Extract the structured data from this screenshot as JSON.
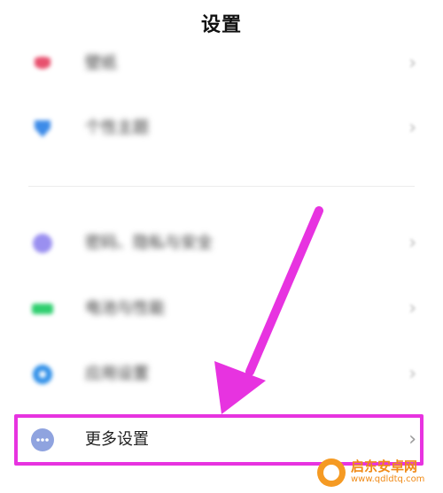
{
  "header": {
    "title": "设置"
  },
  "section1": {
    "items": [
      {
        "label": "壁纸",
        "icon": "wallpaper-icon",
        "color": "#e8506e"
      },
      {
        "label": "个性主题",
        "icon": "theme-icon",
        "color": "#3d8be8"
      }
    ]
  },
  "section2": {
    "items": [
      {
        "label": "密码、隐私与安全",
        "icon": "privacy-icon",
        "color": "#9a8ff0"
      },
      {
        "label": "电池与性能",
        "icon": "battery-icon",
        "color": "#2fcf6f"
      },
      {
        "label": "应用设置",
        "icon": "app-settings-icon",
        "color": "#2f8fe8"
      }
    ]
  },
  "more": {
    "label": "更多设置",
    "icon": "more-dots-icon",
    "color": "#8fa3df"
  },
  "chevron": "›",
  "watermark": {
    "name": "启东安卓网",
    "url": "www.qdldtq.com"
  },
  "colors": {
    "annotation": "#e733e0",
    "watermark": "#f08a16"
  }
}
